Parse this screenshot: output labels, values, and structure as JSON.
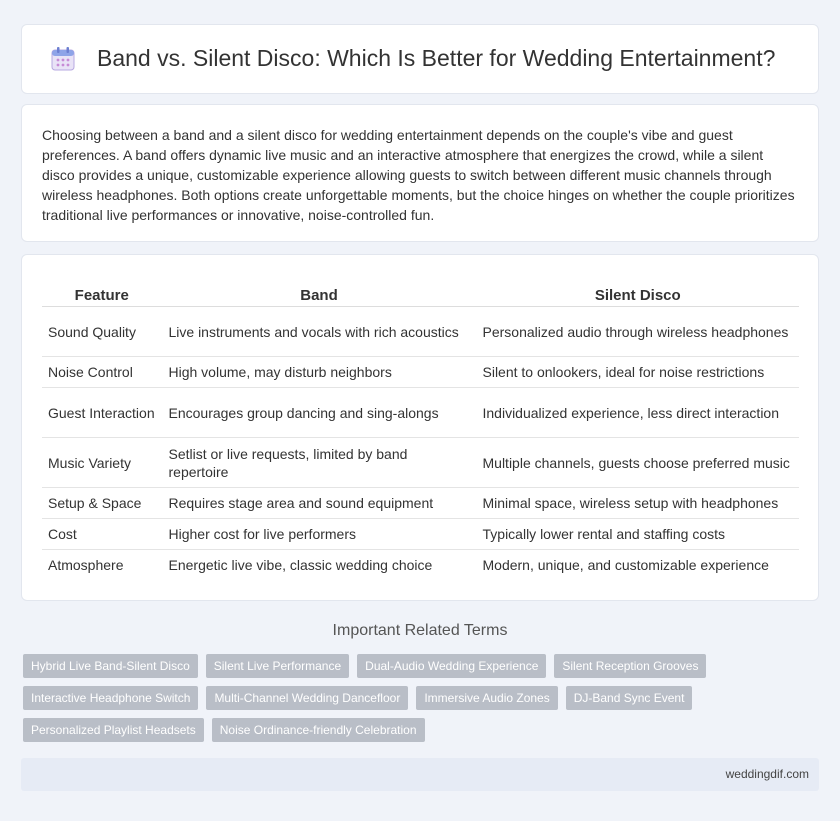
{
  "header": {
    "title": "Band vs. Silent Disco: Which Is Better for Wedding Entertainment?",
    "icon": "calendar-icon"
  },
  "intro": {
    "text": "Choosing between a band and a silent disco for wedding entertainment depends on the couple's vibe and guest preferences. A band offers dynamic live music and an interactive atmosphere that energizes the crowd, while a silent disco provides a unique, customizable experience allowing guests to switch between different music channels through wireless headphones. Both options create unforgettable moments, but the choice hinges on whether the couple prioritizes traditional live performances or innovative, noise-controlled fun."
  },
  "table": {
    "headers": [
      "Feature",
      "Band",
      "Silent Disco"
    ],
    "rows": [
      [
        "Sound Quality",
        "Live instruments and vocals with rich acoustics",
        "Personalized audio through wireless headphones"
      ],
      [
        "Noise Control",
        "High volume, may disturb neighbors",
        "Silent to onlookers, ideal for noise restrictions"
      ],
      [
        "Guest Interaction",
        "Encourages group dancing and sing-alongs",
        "Individualized experience, less direct interaction"
      ],
      [
        "Music Variety",
        "Setlist or live requests, limited by band repertoire",
        "Multiple channels, guests choose preferred music"
      ],
      [
        "Setup & Space",
        "Requires stage area and sound equipment",
        "Minimal space, wireless setup with headphones"
      ],
      [
        "Cost",
        "Higher cost for live performers",
        "Typically lower rental and staffing costs"
      ],
      [
        "Atmosphere",
        "Energetic live vibe, classic wedding choice",
        "Modern, unique, and customizable experience"
      ]
    ]
  },
  "related": {
    "title": "Important Related Terms",
    "tags": [
      "Hybrid Live Band-Silent Disco",
      "Silent Live Performance",
      "Dual-Audio Wedding Experience",
      "Silent Reception Grooves",
      "Interactive Headphone Switch",
      "Multi-Channel Wedding Dancefloor",
      "Immersive Audio Zones",
      "DJ-Band Sync Event",
      "Personalized Playlist Headsets",
      "Noise Ordinance-friendly Celebration"
    ]
  },
  "footer": {
    "site": "weddingdif.com"
  }
}
